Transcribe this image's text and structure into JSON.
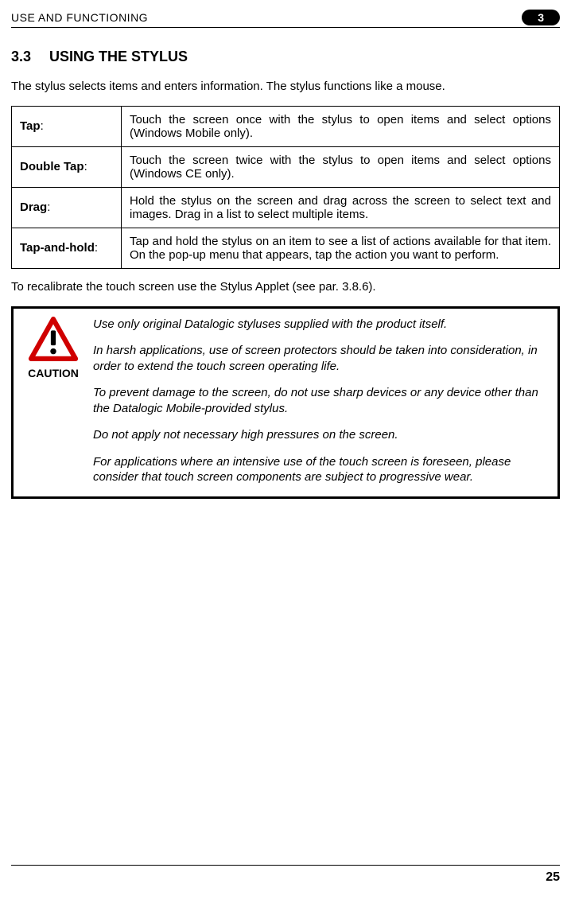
{
  "header": {
    "title": "USE AND FUNCTIONING",
    "chapter_badge": "3"
  },
  "section": {
    "number": "3.3",
    "title": "USING THE STYLUS"
  },
  "intro": "The stylus selects items and enters information. The stylus functions like a mouse.",
  "table": {
    "rows": [
      {
        "label": "Tap",
        "desc": "Touch the screen once with the stylus to open items and select options (Windows Mobile only)."
      },
      {
        "label": "Double Tap",
        "desc": "Touch the screen twice with the stylus to open items and select options (Windows CE only)."
      },
      {
        "label": "Drag",
        "desc": "Hold the stylus on the screen and drag across the screen to select text and images. Drag in a list to select multiple items."
      },
      {
        "label": "Tap-and-hold",
        "desc": "Tap and hold the stylus on an item to see a list of actions available for that item. On the pop-up menu that appears, tap the action you want to perform."
      }
    ]
  },
  "recalibrate": "To recalibrate the touch screen use the Stylus Applet (see par. 3.8.6).",
  "caution": {
    "label": "CAUTION",
    "paragraphs": [
      "Use only original Datalogic styluses supplied with the product itself.",
      "In harsh applications, use of screen protectors should be taken into consideration, in order to extend the touch screen operating life.",
      "To prevent damage to the screen, do not use sharp devices or any device other than the Datalogic Mobile-provided stylus.",
      "Do not apply not necessary high pressures on the screen.",
      "For applications where an intensive use of the touch screen is foreseen, please consider that touch screen components are subject to progressive wear."
    ]
  },
  "footer": {
    "page": "25"
  }
}
